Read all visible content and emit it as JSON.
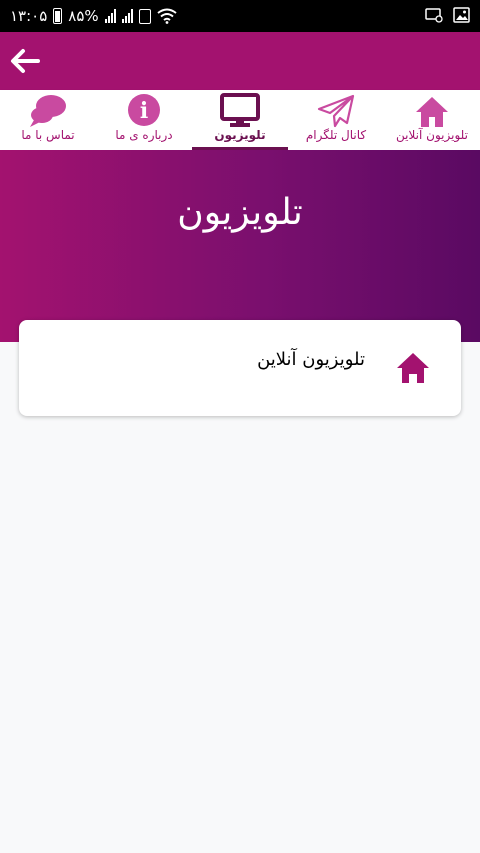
{
  "status_bar": {
    "time": "۱۳:۰۵",
    "battery": "۸۵%"
  },
  "colors": {
    "primary": "#a3126f",
    "dark": "#6b1050",
    "gradient_end": "#5a0a62"
  },
  "tabs": [
    {
      "label": "تلویزیون آنلاین",
      "icon": "home-icon"
    },
    {
      "label": "کانال تلگرام",
      "icon": "telegram-icon"
    },
    {
      "label": "تلویزیون",
      "icon": "tv-icon",
      "active": true
    },
    {
      "label": "درباره ی ما",
      "icon": "info-icon"
    },
    {
      "label": "تماس با ما",
      "icon": "chat-icon"
    }
  ],
  "hero": {
    "title": "تلویزیون"
  },
  "card": {
    "label": "تلویزیون آنلاین",
    "icon": "home-icon"
  }
}
